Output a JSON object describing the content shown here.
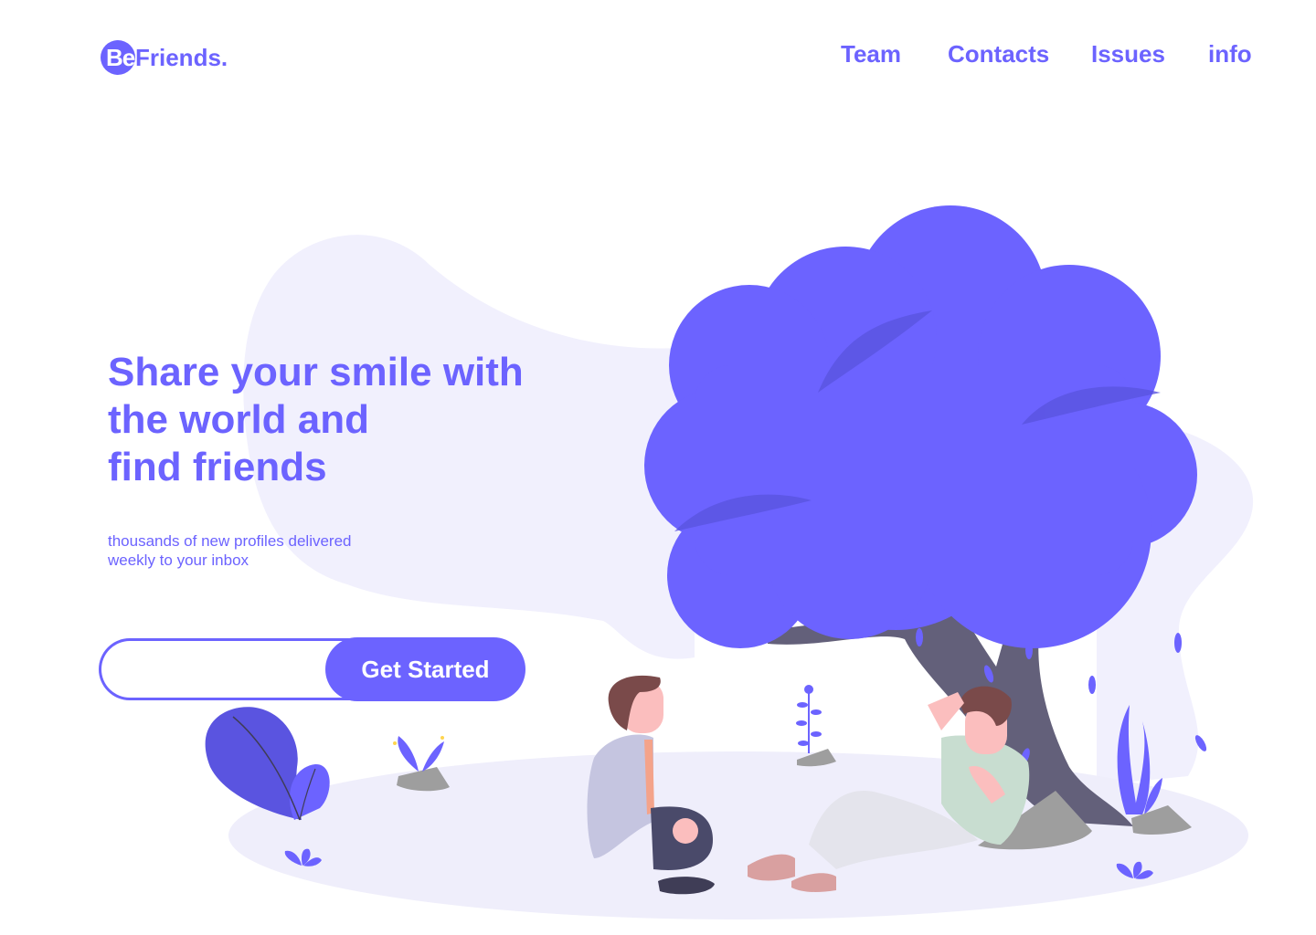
{
  "brand": {
    "logo_mark": "Be",
    "logo_text": "Friends."
  },
  "nav": {
    "items": [
      {
        "label": "Team"
      },
      {
        "label": "Contacts"
      },
      {
        "label": "Issues"
      },
      {
        "label": "info"
      }
    ]
  },
  "hero": {
    "title_lines": [
      "Share your  smile with",
      "the world and",
      "find friends"
    ],
    "subtitle_lines": [
      "thousands of new profiles delivered",
      "weekly to your inbox"
    ],
    "email_value": "",
    "cta_label": "Get Started"
  },
  "illustration": {
    "subject": "two people relaxing under a tree",
    "icons": [
      "tree-icon",
      "person-icon",
      "plant-icon",
      "rock-icon",
      "leaf-icon"
    ]
  },
  "colors": {
    "accent": "#6c63ff",
    "accent_dark": "#5a54e0",
    "blob": "#f1f0fd",
    "ground": "#efeefb",
    "trunk": "#63607a",
    "rock": "#9e9e9e",
    "skin": "#fbbebe",
    "hair": "#7a4a4a",
    "text_dark": "#3f3d56"
  }
}
